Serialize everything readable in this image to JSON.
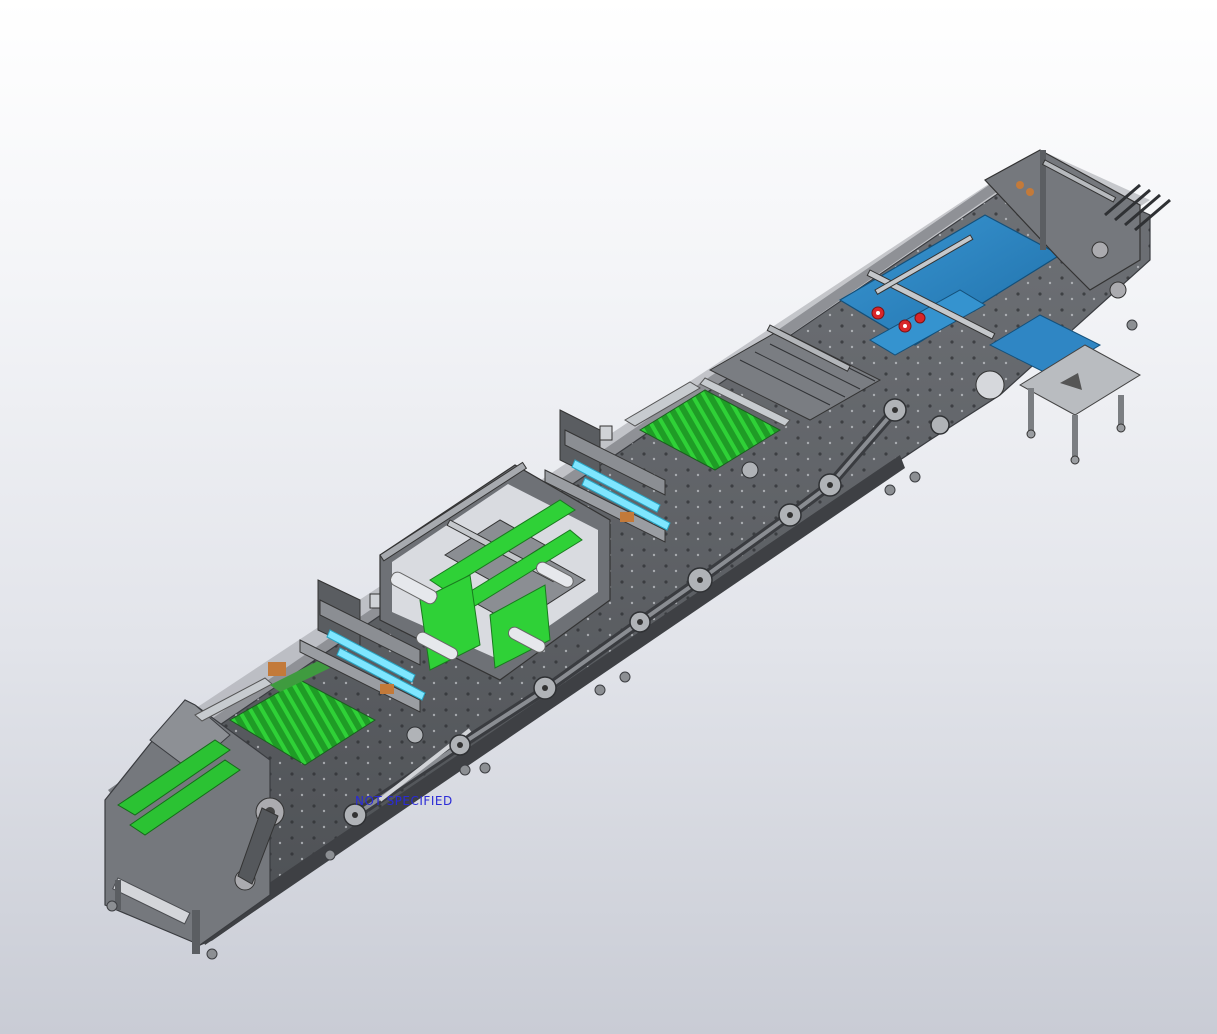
{
  "viewport": {
    "background_top": "#ffffff",
    "background_bottom": "#c9ccd5"
  },
  "model": {
    "annotation_text": "NOT SPECIFIED",
    "colors": {
      "frame": "#6b6e72",
      "frame_dark": "#44474b",
      "frame_light": "#9a9da2",
      "belt_green": "#22b327",
      "belt_blue": "#2f86c4",
      "roller": "#d9dde2",
      "accent_red": "#d8262a",
      "accent_cyan": "#7fe6ff",
      "annotation": "#2a2ad6"
    }
  }
}
